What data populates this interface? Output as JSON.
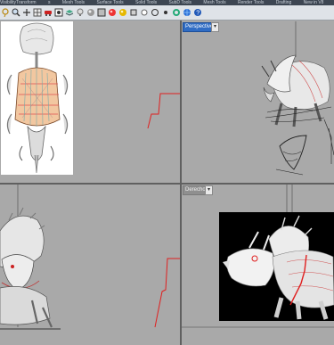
{
  "menubar": {
    "items": [
      "VisibilityTransform",
      "s",
      "Mesh Tools",
      "Surface Tools",
      "Solid Tools",
      "SubD Tools",
      "Mesh Tools",
      "Render Tools",
      "Drafting",
      "New in V8"
    ]
  },
  "toolbar": {
    "icons": [
      "lasso-icon",
      "zoom-icon",
      "pan-icon",
      "grid-icon",
      "car-icon",
      "osnap-icon",
      "layer-icon",
      "lamp-icon",
      "sphere-icon",
      "shade-icon",
      "render-icon",
      "material-icon",
      "box-icon",
      "light-icon",
      "circle-icon",
      "dot-icon",
      "gear-icon",
      "globe-icon",
      "help-icon"
    ]
  },
  "viewports": {
    "top_left": {
      "label": ""
    },
    "perspective": {
      "label": "Perspective"
    },
    "front": {
      "label": ""
    },
    "right": {
      "label": "Derecho"
    }
  },
  "colors": {
    "viewport_bg": "#a9a9a9",
    "active_label": "#2f6cc4",
    "curve_red": "#e02020",
    "reference_bg_white": "#ffffff",
    "reference_bg_black": "#000000"
  }
}
